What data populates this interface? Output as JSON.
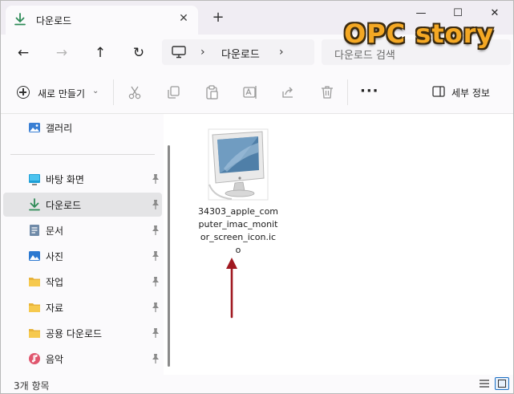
{
  "tab": {
    "title": "다운로드",
    "close": "✕",
    "new": "+"
  },
  "window_controls": {
    "minimize": "—",
    "maximize": "☐",
    "close": "✕"
  },
  "nav": {
    "back": "←",
    "forward": "→",
    "up": "↑",
    "refresh": "↻",
    "breadcrumb_sep": "›",
    "location": "다운로드",
    "search_placeholder": "다운로드 검색"
  },
  "watermark": "OPC story",
  "commands": {
    "new_label": "새로 만들기",
    "new_caret": "⌄",
    "more": "···",
    "details_label": "세부 정보",
    "icons": [
      "cut-icon",
      "copy-icon",
      "paste-icon",
      "rename-icon",
      "share-icon",
      "delete-icon"
    ]
  },
  "sidebar": {
    "items": [
      {
        "label": "갤러리",
        "icon": "gallery-icon",
        "pinned": false,
        "selected": false
      },
      {
        "label": "바탕 화면",
        "icon": "desktop-icon",
        "pinned": true,
        "selected": false
      },
      {
        "label": "다운로드",
        "icon": "download-icon",
        "pinned": true,
        "selected": true
      },
      {
        "label": "문서",
        "icon": "documents-icon",
        "pinned": true,
        "selected": false
      },
      {
        "label": "사진",
        "icon": "pictures-icon",
        "pinned": true,
        "selected": false
      },
      {
        "label": "작업",
        "icon": "folder-icon",
        "pinned": true,
        "selected": false
      },
      {
        "label": "자료",
        "icon": "folder-icon",
        "pinned": true,
        "selected": false
      },
      {
        "label": "공용 다운로드",
        "icon": "folder-icon",
        "pinned": true,
        "selected": false
      },
      {
        "label": "음악",
        "icon": "music-icon",
        "pinned": true,
        "selected": false
      }
    ]
  },
  "files": [
    {
      "name": "34303_apple_computer_imac_monitor_screen_icon.ico",
      "icon": "imac-monitor-icon"
    }
  ],
  "status": {
    "count_text": "3개 항목"
  },
  "colors": {
    "accent": "#1a6fc4",
    "download_green": "#2e8b57",
    "arrow_red": "#a01820",
    "watermark": "#f4a824"
  }
}
